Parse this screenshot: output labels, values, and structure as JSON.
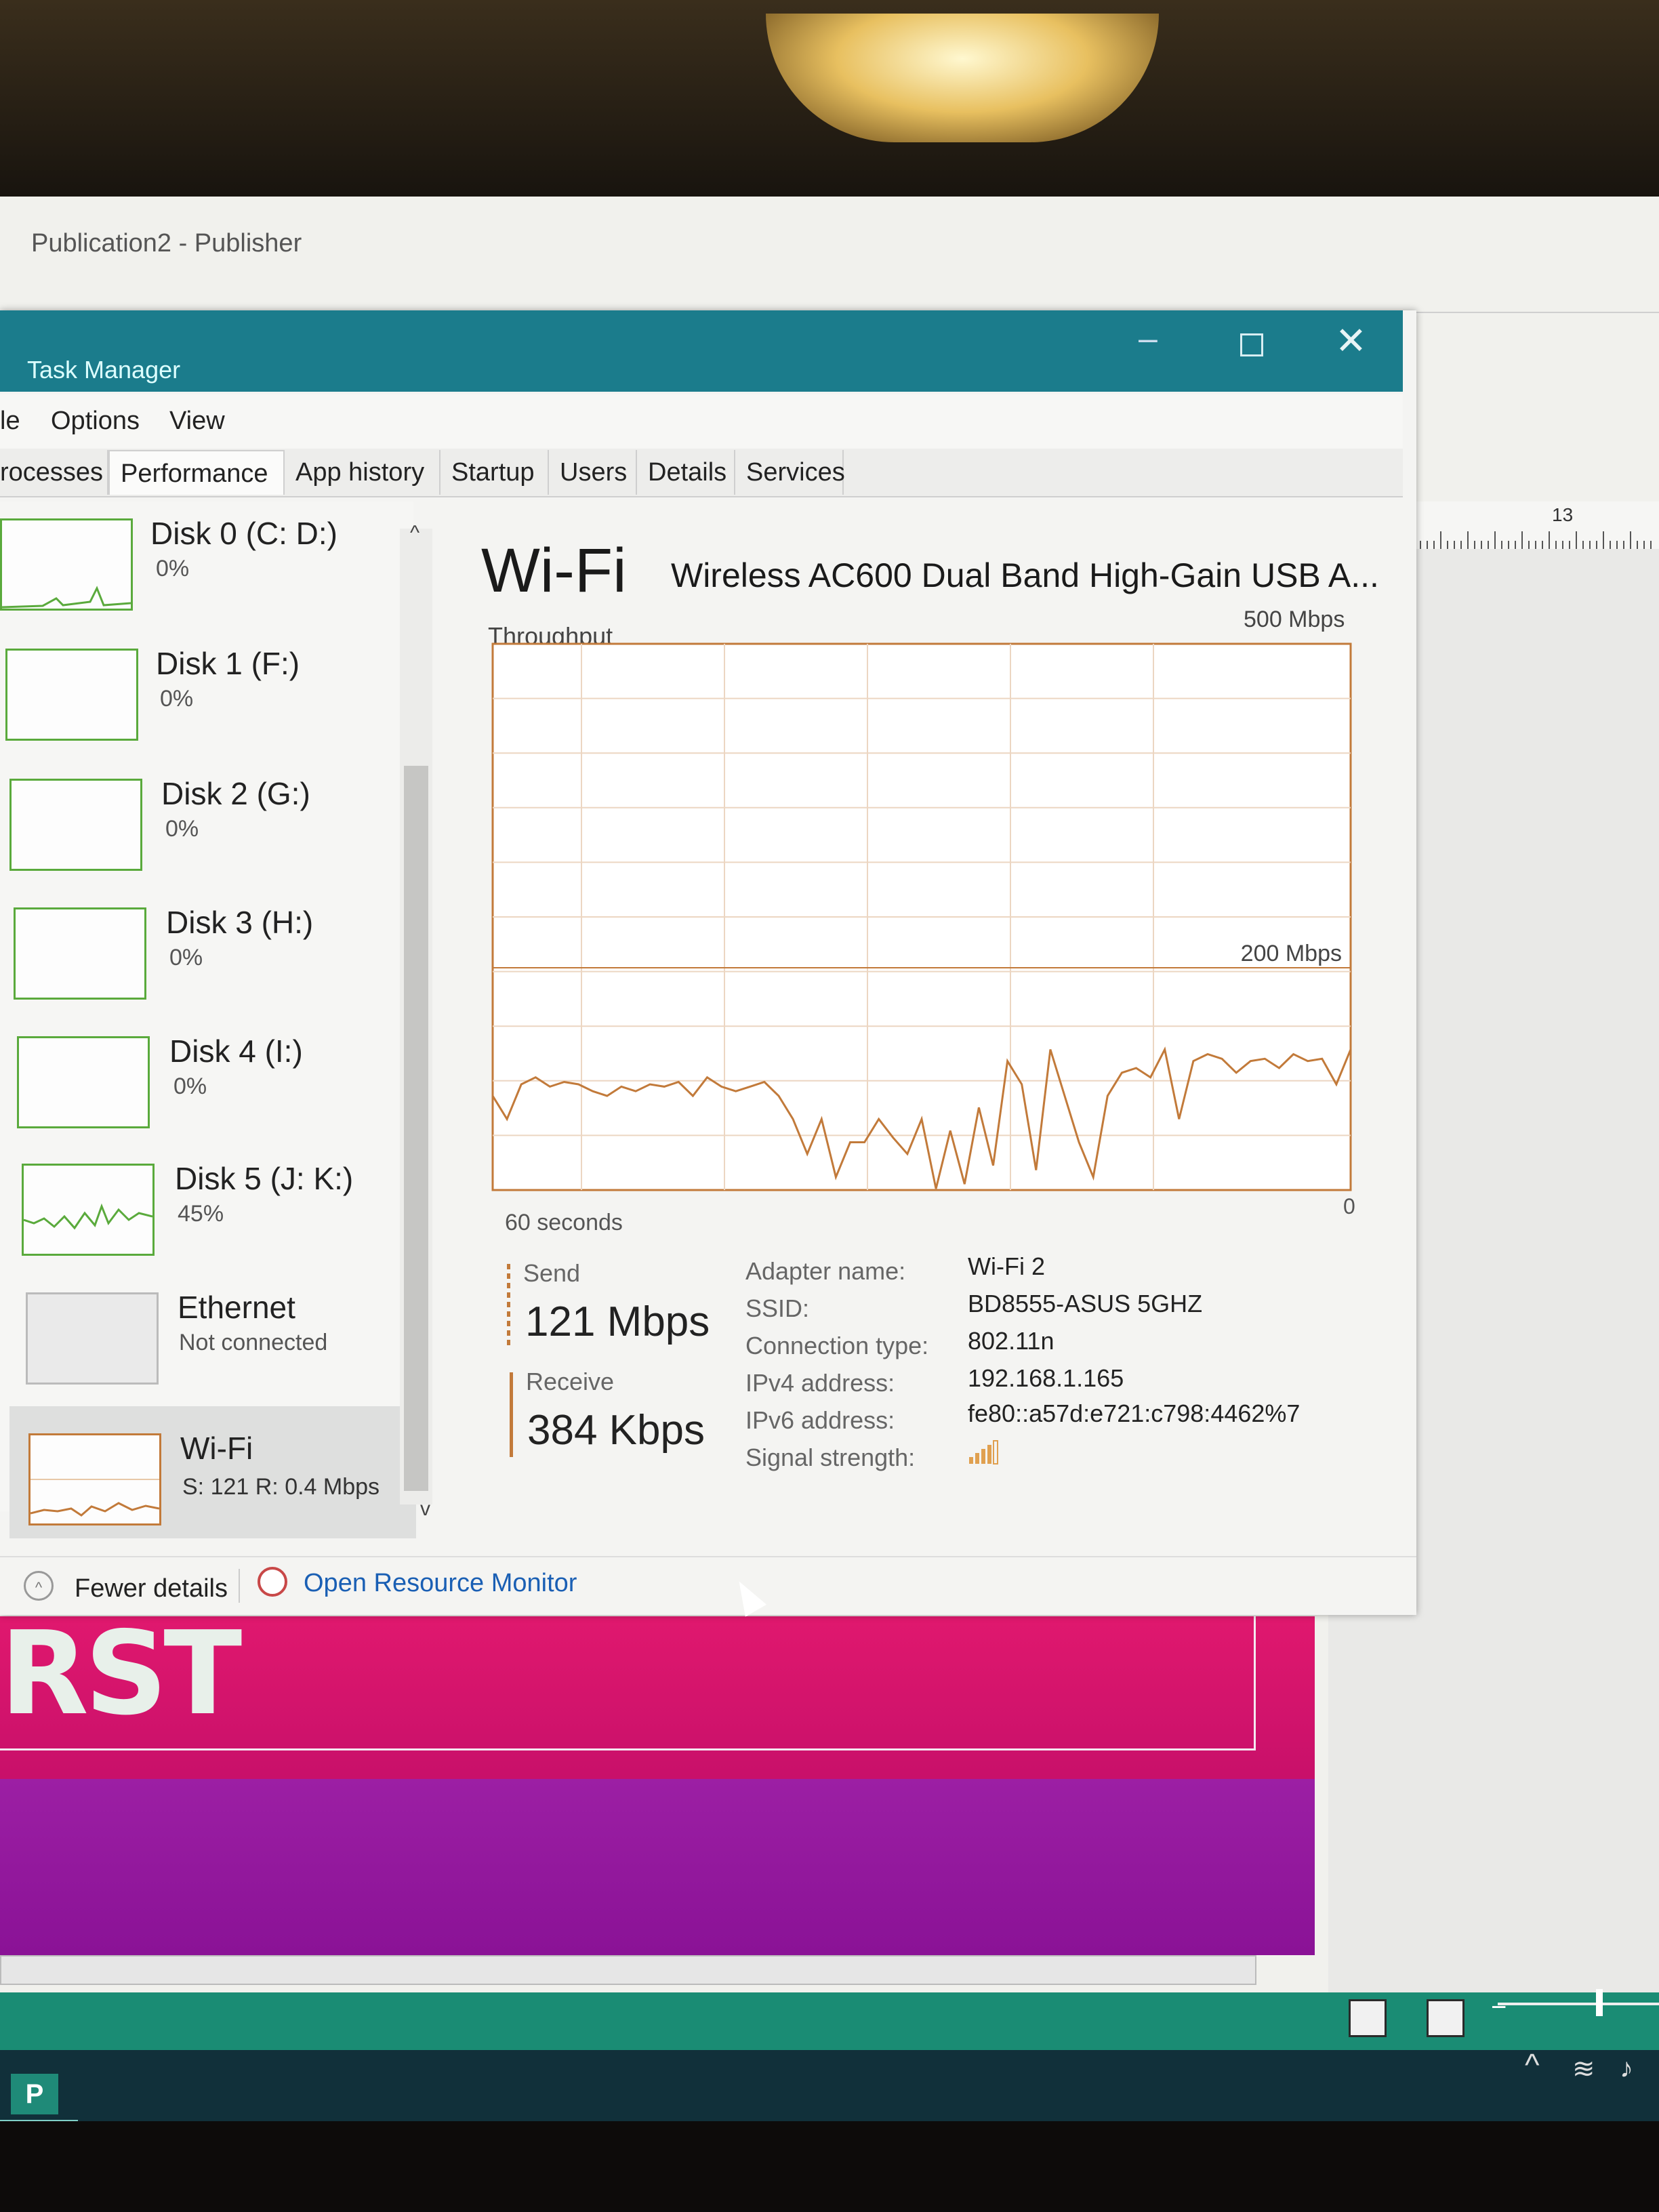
{
  "publisher": {
    "window_title": "Publication2 - Publisher",
    "ruler_number": "13",
    "page_text": "RST",
    "taskbar_app_icon": "P"
  },
  "task_manager": {
    "title": "Task Manager",
    "menu": [
      "le",
      "Options",
      "View"
    ],
    "tabs": [
      "rocesses",
      "Performance",
      "App history",
      "Startup",
      "Users",
      "Details",
      "Services"
    ],
    "active_tab": "Performance",
    "sidebar": {
      "items": [
        {
          "name": "Disk 0 (C: D:)",
          "value": "0%"
        },
        {
          "name": "Disk 1 (F:)",
          "value": "0%"
        },
        {
          "name": "Disk 2 (G:)",
          "value": "0%"
        },
        {
          "name": "Disk 3 (H:)",
          "value": "0%"
        },
        {
          "name": "Disk 4 (I:)",
          "value": "0%"
        },
        {
          "name": "Disk 5 (J: K:)",
          "value": "45%"
        },
        {
          "name": "Ethernet",
          "value": "Not connected"
        },
        {
          "name": "Wi-Fi",
          "value": "S: 121  R: 0.4 Mbps"
        }
      ],
      "selected": "Wi-Fi"
    },
    "main": {
      "title": "Wi-Fi",
      "adapter": "Wireless AC600 Dual Band High-Gain USB A...",
      "graph_label": "Throughput",
      "max_label": "500 Mbps",
      "mid_label": "200 Mbps",
      "x_label": "60 seconds",
      "zero_label": "0",
      "send_label": "Send",
      "send_value": "121 Mbps",
      "receive_label": "Receive",
      "receive_value": "384 Kbps",
      "properties": [
        {
          "key": "Adapter name:",
          "value": "Wi-Fi 2"
        },
        {
          "key": "SSID:",
          "value": "BD8555-ASUS 5GHZ"
        },
        {
          "key": "Connection type:",
          "value": "802.11n"
        },
        {
          "key": "IPv4 address:",
          "value": "192.168.1.165"
        },
        {
          "key": "IPv6 address:",
          "value": "fe80::a57d:e721:c798:4462%7"
        },
        {
          "key": "Signal strength:",
          "value": ""
        }
      ]
    },
    "footer": {
      "fewer_details": "Fewer details",
      "resource_monitor": "Open Resource Monitor"
    }
  },
  "chart_data": {
    "type": "line",
    "title": "Throughput",
    "xlabel": "60 seconds",
    "ylabel": "",
    "ylim": [
      0,
      200
    ],
    "xlim": [
      60,
      0
    ],
    "series": [
      {
        "name": "Send",
        "color": "#c27a3a",
        "values": [
          40,
          30,
          45,
          48,
          44,
          46,
          45,
          42,
          40,
          44,
          42,
          45,
          44,
          46,
          40,
          48,
          44,
          42,
          44,
          46,
          40,
          30,
          15,
          30,
          5,
          20,
          20,
          30,
          22,
          15,
          30,
          0,
          25,
          2,
          35,
          10,
          55,
          45,
          8,
          60,
          40,
          20,
          5,
          40,
          50,
          52,
          48,
          60,
          30,
          55,
          58,
          56,
          50,
          55,
          56,
          52,
          58,
          55,
          56,
          45,
          60
        ]
      }
    ]
  },
  "colors": {
    "titlebar": "#1b7c8c",
    "send_line": "#c27a3a",
    "disk_green": "#5aaa3c",
    "link_blue": "#1a5fb4"
  }
}
